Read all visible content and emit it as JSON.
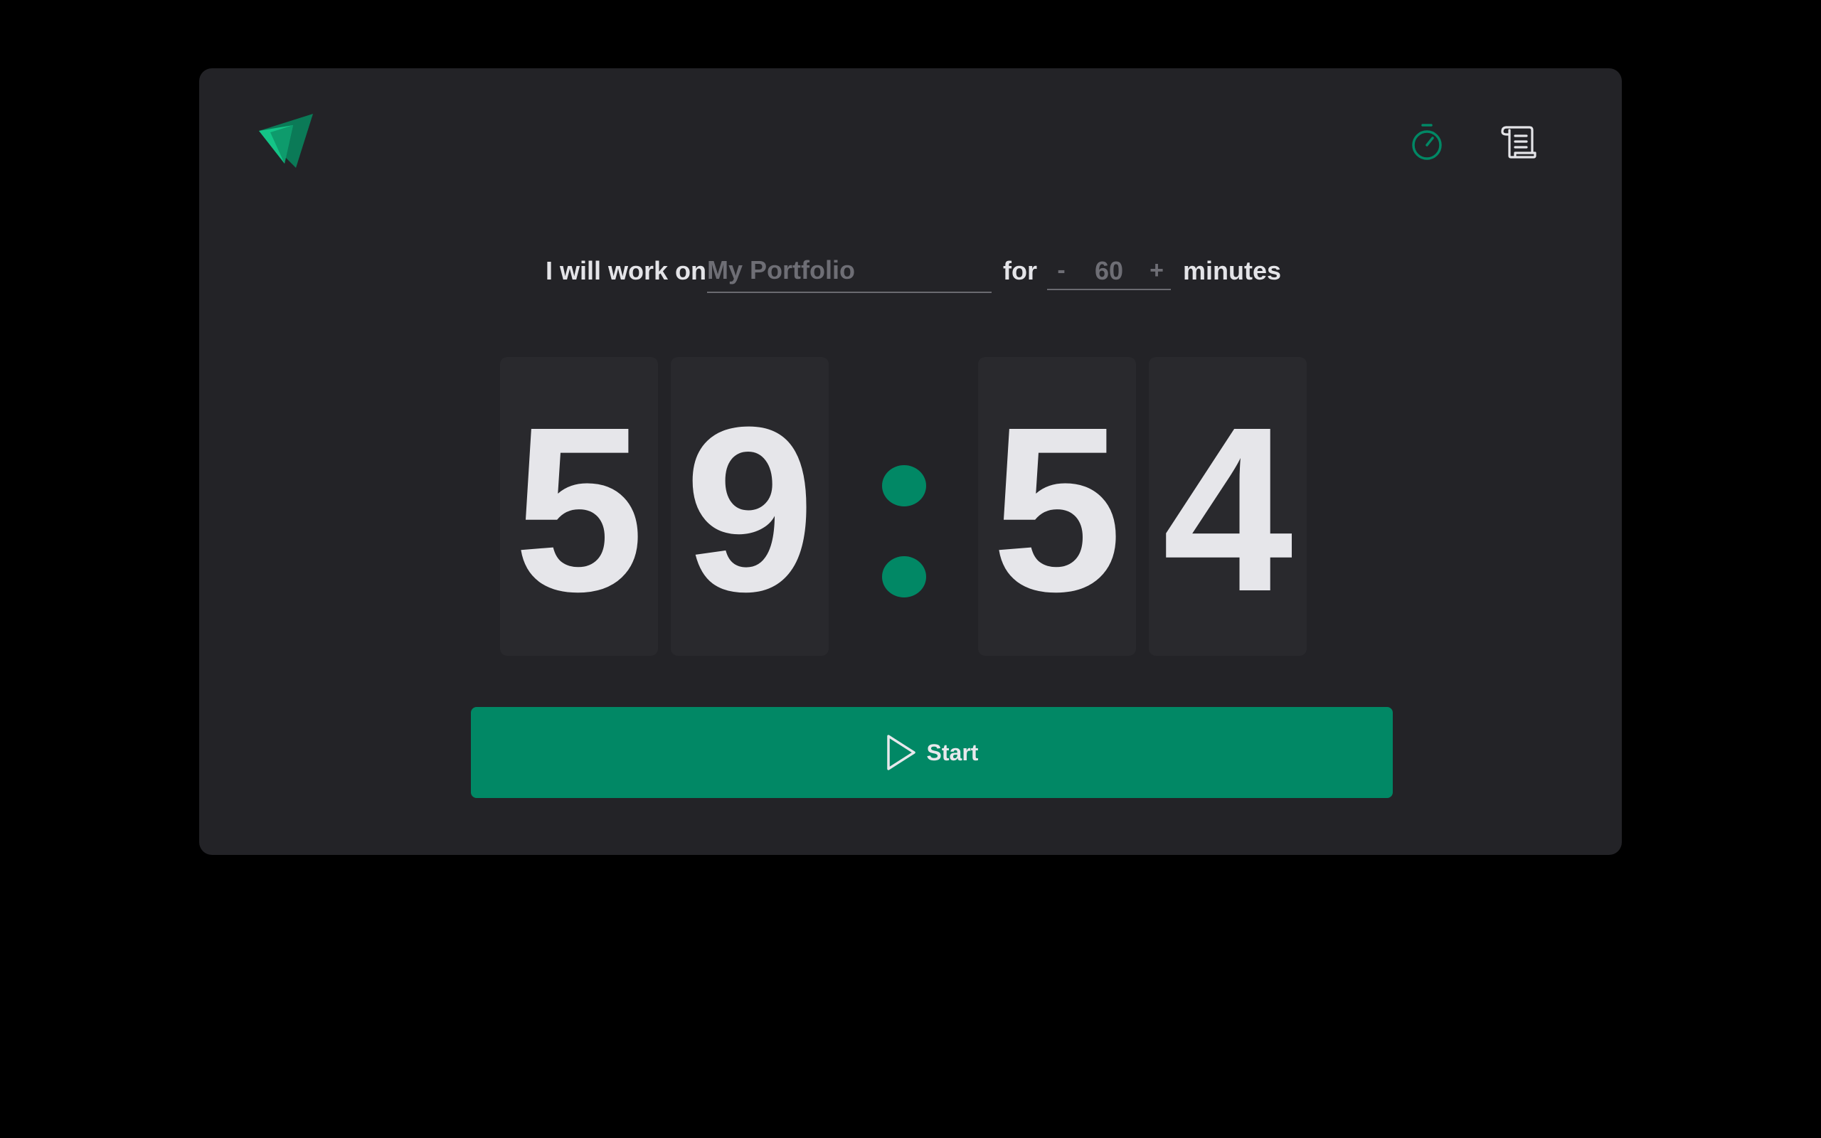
{
  "task": {
    "prefix": "I will work on",
    "placeholder": "My Portfolio",
    "value": "",
    "for_label": "for",
    "decrement": "-",
    "duration": "60",
    "increment": "+",
    "suffix": "minutes"
  },
  "timer": {
    "digits": [
      "5",
      "9",
      "5",
      "4"
    ]
  },
  "actions": {
    "start_label": "Start"
  },
  "icons": {
    "logo": "paper-plane-logo",
    "timer": "stopwatch-icon",
    "log": "scroll-icon",
    "start": "play-icon"
  },
  "colors": {
    "accent": "#018865",
    "card": "#232327",
    "digit_tile": "#29292d",
    "text": "#e4e4e8",
    "muted": "#6e6e75"
  }
}
